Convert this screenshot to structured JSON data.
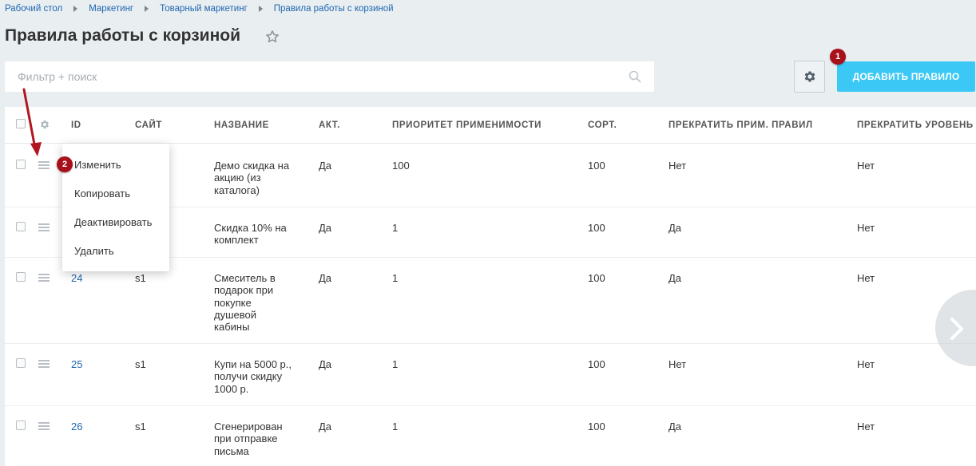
{
  "breadcrumb": [
    "Рабочий стол",
    "Маркетинг",
    "Товарный маркетинг",
    "Правила работы с корзиной"
  ],
  "page_title": "Правила работы с корзиной",
  "filter": {
    "placeholder": "Фильтр + поиск"
  },
  "add_button_label": "ДОБАВИТЬ ПРАВИЛО",
  "markers": [
    "1",
    "2"
  ],
  "table": {
    "columns": [
      "ID",
      "САЙТ",
      "НАЗВАНИЕ",
      "АКТ.",
      "ПРИОРИТЕТ ПРИМЕНИМОСТИ",
      "СОРТ.",
      "ПРЕКРАТИТЬ ПРИМ. ПРАВИЛ",
      "ПРЕКРАТИТЬ УРОВЕНЬ"
    ],
    "rows": [
      {
        "id": "",
        "site": "",
        "name": "Демо скидка на акцию (из каталога)",
        "active": "Да",
        "priority": "100",
        "sort": "100",
        "stop_rules": "Нет",
        "stop_level": "Нет"
      },
      {
        "id": "",
        "site": "",
        "name": "Скидка 10% на комплект",
        "active": "Да",
        "priority": "1",
        "sort": "100",
        "stop_rules": "Да",
        "stop_level": "Нет"
      },
      {
        "id": "24",
        "site": "s1",
        "name": "Смеситель в подарок при покупке душевой кабины",
        "active": "Да",
        "priority": "1",
        "sort": "100",
        "stop_rules": "Да",
        "stop_level": "Нет"
      },
      {
        "id": "25",
        "site": "s1",
        "name": "Купи на 5000 р., получи скидку 1000 р.",
        "active": "Да",
        "priority": "1",
        "sort": "100",
        "stop_rules": "Нет",
        "stop_level": "Нет"
      },
      {
        "id": "26",
        "site": "s1",
        "name": "Сгенерирован при отправке письма",
        "active": "Да",
        "priority": "1",
        "sort": "100",
        "stop_rules": "Да",
        "stop_level": "Нет"
      }
    ]
  },
  "context_menu": [
    "Изменить",
    "Копировать",
    "Деактивировать",
    "Удалить"
  ],
  "colors": {
    "accent": "#3bc8f5",
    "marker": "#a8101a",
    "link": "#2067b0",
    "background": "#e9eef1"
  },
  "icons": [
    "star-icon",
    "search-icon",
    "gear-icon",
    "menu-icon",
    "chevron-right-icon"
  ]
}
